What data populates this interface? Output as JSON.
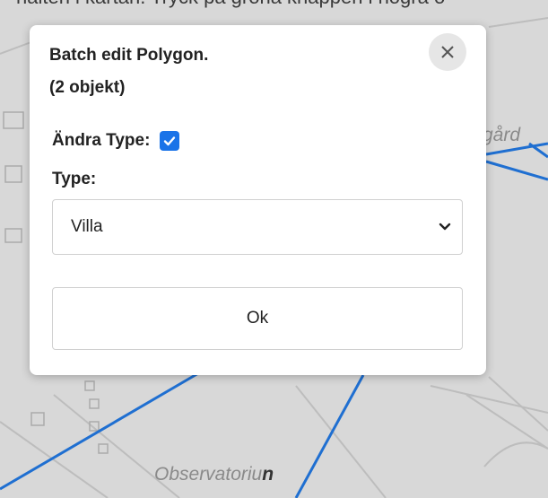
{
  "map": {
    "top_text": "halten i kartan. Tryck på gröna knappen i högra ö",
    "right_text": "gård",
    "label_observatorium": "Observatoriu",
    "label_observatorium_tail": "n"
  },
  "dialog": {
    "title_line1": "Batch edit Polygon.",
    "title_line2": "(2 objekt)",
    "close_icon": "close-icon",
    "change_label": "Ändra Type:",
    "change_checked": true,
    "type_label": "Type:",
    "type_value": "Villa",
    "ok_label": "Ok"
  },
  "colors": {
    "accent": "#1a73e8",
    "map_line": "#1f6fd1",
    "map_bg": "#d8d8d8"
  }
}
